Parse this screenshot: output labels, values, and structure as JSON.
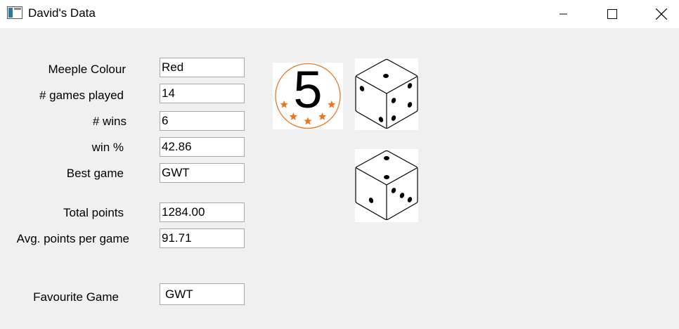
{
  "window": {
    "title": "David's Data",
    "controls": [
      "minimize",
      "maximize",
      "close"
    ]
  },
  "form": {
    "meeple_colour": {
      "label": "Meeple Colour",
      "value": "Red"
    },
    "games_played": {
      "label": "# games played",
      "value": "14"
    },
    "wins": {
      "label": "# wins",
      "value": "6"
    },
    "win_pct": {
      "label": "win %",
      "value": "42.86"
    },
    "best_game": {
      "label": "Best game",
      "value": "GWT"
    },
    "total_points": {
      "label": "Total points",
      "value": "1284.00"
    },
    "avg_points": {
      "label": "Avg. points per game",
      "value": "91.71"
    },
    "favourite_game": {
      "label": "Favourite Game",
      "value": "GWT"
    }
  },
  "images": {
    "badge": {
      "icon": "rating-badge-icon",
      "number": "5",
      "stars": 5,
      "accent": "#e87722"
    },
    "die_top": {
      "icon": "die-icon"
    },
    "die_bottom": {
      "icon": "die-icon"
    }
  }
}
